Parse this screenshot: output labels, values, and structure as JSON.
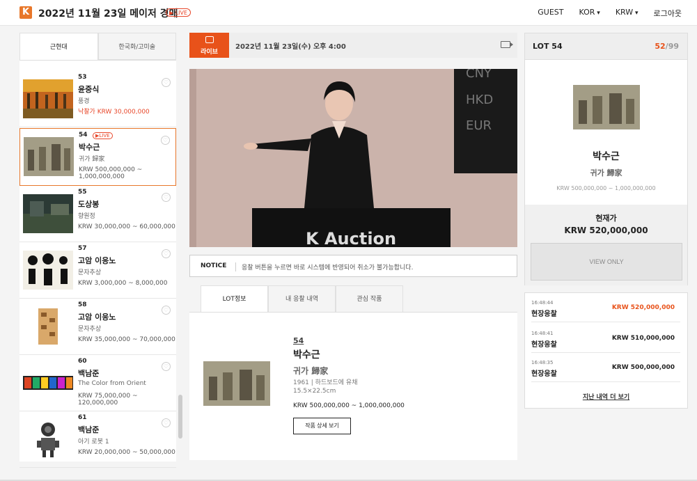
{
  "header": {
    "logo": "K",
    "title": "2022년 11월 23일 메이저 경매",
    "live_badge": "LIVE",
    "nav": {
      "user": "GUEST",
      "lang": "KOR",
      "currency": "KRW",
      "logout": "로그아웃"
    }
  },
  "left_tabs": [
    "근현대",
    "한국화/고미술"
  ],
  "lots": [
    {
      "num": "53",
      "artist": "윤중식",
      "work": "풍경",
      "price": "낙찰가 KRW 30,000,000",
      "sold": true
    },
    {
      "num": "54",
      "artist": "박수근",
      "work": "귀가 歸家",
      "price": "KRW 500,000,000 ~ 1,000,000,000",
      "live": "LIVE"
    },
    {
      "num": "55",
      "artist": "도상봉",
      "work": "향원정",
      "price": "KRW 30,000,000 ~ 60,000,000"
    },
    {
      "num": "57",
      "artist": "고암 이응노",
      "work": "문자추상",
      "price": "KRW 3,000,000 ~ 8,000,000"
    },
    {
      "num": "58",
      "artist": "고암 이응노",
      "work": "문자추상",
      "price": "KRW 35,000,000 ~ 70,000,000"
    },
    {
      "num": "60",
      "artist": "백남준",
      "work": "The Color from Orient",
      "price": "KRW 75,000,000 ~ 120,000,000"
    },
    {
      "num": "61",
      "artist": "백남준",
      "work": "아기 로봇 1",
      "price": "KRW 20,000,000 ~ 50,000,000"
    }
  ],
  "live_header": {
    "label": "라이브",
    "date": "2022년 11월 23일(수) 오후 4:00"
  },
  "video": {
    "sign": "K Auction",
    "currencies": [
      "CNY",
      "HKD",
      "EUR"
    ]
  },
  "notice": {
    "label": "NOTICE",
    "text": "응찰 버튼을 누르면 바로 시스템에 반영되어 취소가 불가능합니다."
  },
  "mid_tabs": [
    "LOT정보",
    "내 응찰 내역",
    "관심 작품"
  ],
  "detail": {
    "num": "54",
    "artist": "박수근",
    "work": "귀가 歸家",
    "meta_line1": "1961 | 하드보드에 유채",
    "meta_line2": "15.5×22.5cm",
    "estimate": "KRW 500,000,000 ~ 1,000,000,000",
    "button": "작품 상세 보기"
  },
  "right": {
    "lot_label": "LOT 54",
    "current_index": "52",
    "total": "/99",
    "artist": "박수근",
    "work": "귀가 歸家",
    "estimate": "KRW 500,000,000 ~ 1,000,000,000",
    "current_label": "현재가",
    "current_price": "KRW 520,000,000",
    "view_only": "VIEW ONLY"
  },
  "bids": [
    {
      "time": "16:48:44",
      "type": "현장응찰",
      "amount": "KRW 520,000,000"
    },
    {
      "time": "16:48:41",
      "type": "현장응찰",
      "amount": "KRW 510,000,000"
    },
    {
      "time": "16:48:35",
      "type": "현장응찰",
      "amount": "KRW 500,000,000"
    }
  ],
  "more_link": "지난 내역 더 보기",
  "colors": {
    "accent": "#e8521a",
    "orange": "#e8772a"
  }
}
